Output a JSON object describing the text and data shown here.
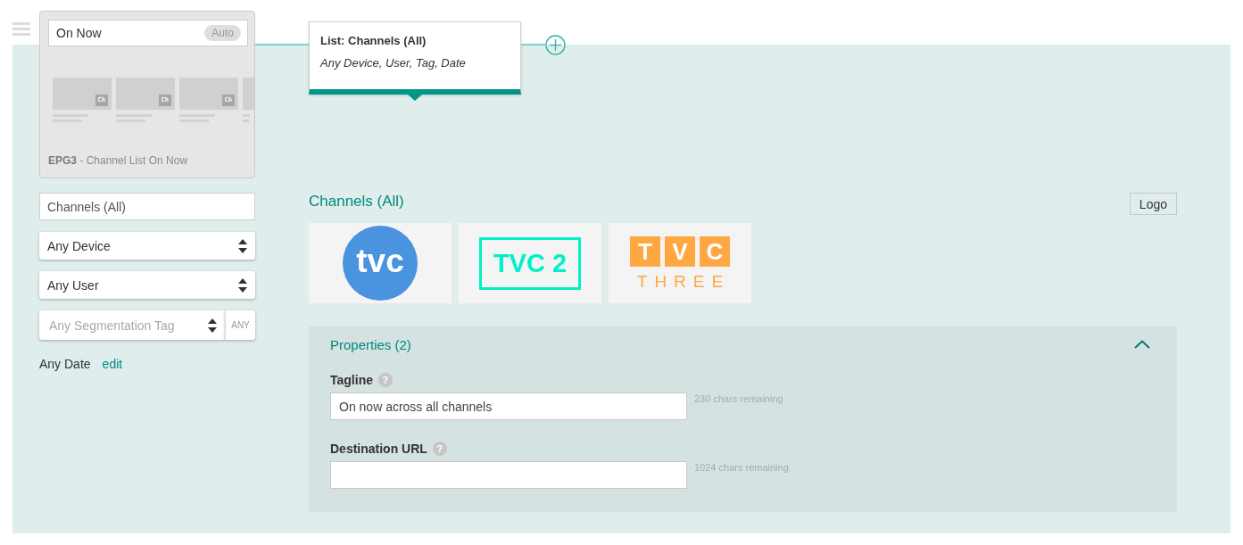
{
  "template_card": {
    "title_field": {
      "value": "On Now",
      "badge": "Auto"
    },
    "thumbnails": [
      {
        "badge": "Ch",
        "cut_off": false
      },
      {
        "badge": "Ch",
        "cut_off": false
      },
      {
        "badge": "Ch",
        "cut_off": false
      },
      {
        "cut_off": true
      }
    ],
    "caption": "**EPG3** - Channel List On Now"
  },
  "tooltip": {
    "title": "List: Channels (All)",
    "subtitle": "Any Device, User, Tag, Date"
  },
  "filters": [
    {
      "kind": "text",
      "value": "Channels (All)"
    },
    {
      "kind": "select",
      "value": "Any Device"
    },
    {
      "kind": "select",
      "value": "Any User"
    },
    {
      "kind": "select",
      "placeholder": "Any Segmentation Tag",
      "button": "ANY"
    }
  ],
  "date_filter": {
    "label": "Any Date",
    "link": "edit"
  },
  "channels_section": {
    "title": "Channels (All)",
    "button": "Logo",
    "logos": [
      {
        "kind": "circle",
        "text": "tvc",
        "color": "#4a93df"
      },
      {
        "kind": "outline",
        "text": "TVC 2",
        "color": "#00f0c8"
      },
      {
        "kind": "blocks",
        "letters": [
          "T",
          "V",
          "C"
        ],
        "subtitle": "THREE",
        "color": "#ffa843"
      }
    ]
  },
  "properties": {
    "title": "Properties (2)",
    "expanded": true,
    "fields": [
      {
        "label": "Tagline",
        "help": "?",
        "value": "On now across all channels",
        "hint": "230 chars remaining"
      },
      {
        "label": "Destination URL",
        "help": "?",
        "hint": "1024 chars remaining"
      }
    ]
  }
}
